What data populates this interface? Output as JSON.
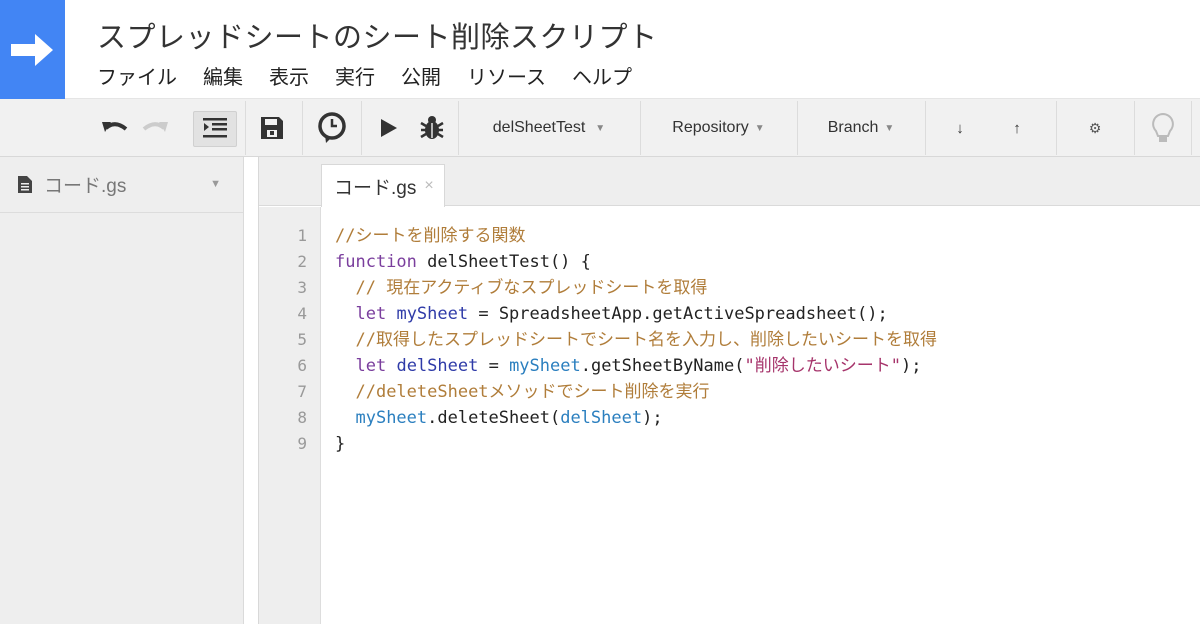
{
  "app": {
    "title": "スプレッドシートのシート削除スクリプト",
    "brand_color": "#4285f4",
    "logo_icon": "arrow-right-icon"
  },
  "menu": [
    {
      "label": "ファイル"
    },
    {
      "label": "編集"
    },
    {
      "label": "表示"
    },
    {
      "label": "実行"
    },
    {
      "label": "公開"
    },
    {
      "label": "リソース"
    },
    {
      "label": "ヘルプ"
    }
  ],
  "toolbar": {
    "undo_icon": "undo-icon",
    "redo_icon": "redo-icon",
    "indent_icon": "indent-icon",
    "save_icon": "save-icon",
    "triggers_icon": "clock-icon",
    "run_icon": "play-icon",
    "debug_icon": "bug-icon",
    "function_select": "delSheetTest",
    "repository_label": "Repository",
    "branch_label": "Branch",
    "pull_icon": "↓",
    "push_icon": "↑",
    "settings_icon": "⚙",
    "hint_icon": "lightbulb-icon"
  },
  "sidebar": {
    "files": [
      {
        "name": "コード.gs",
        "icon": "file-icon"
      }
    ]
  },
  "editor": {
    "tabs": [
      {
        "label": "コード.gs",
        "close": "×"
      }
    ],
    "line_numbers": [
      "1",
      "2",
      "3",
      "4",
      "5",
      "6",
      "7",
      "8",
      "9"
    ],
    "lines": [
      [
        {
          "t": "//シートを削除する関数",
          "c": "cm-comment"
        }
      ],
      [
        {
          "t": "function",
          "c": "cm-keyword"
        },
        {
          "t": " delSheetTest() {",
          "c": "cm-plain"
        }
      ],
      [
        {
          "t": "  ",
          "c": "cm-plain"
        },
        {
          "t": "// 現在アクティブなスプレッドシートを取得",
          "c": "cm-comment"
        }
      ],
      [
        {
          "t": "  ",
          "c": "cm-plain"
        },
        {
          "t": "let",
          "c": "cm-keyword"
        },
        {
          "t": " ",
          "c": "cm-plain"
        },
        {
          "t": "mySheet",
          "c": "cm-def"
        },
        {
          "t": " = SpreadsheetApp.getActiveSpreadsheet();",
          "c": "cm-plain"
        }
      ],
      [
        {
          "t": "  ",
          "c": "cm-plain"
        },
        {
          "t": "//取得したスプレッドシートでシート名を入力し、削除したいシートを取得",
          "c": "cm-comment"
        }
      ],
      [
        {
          "t": "  ",
          "c": "cm-plain"
        },
        {
          "t": "let",
          "c": "cm-keyword"
        },
        {
          "t": " ",
          "c": "cm-plain"
        },
        {
          "t": "delSheet",
          "c": "cm-def"
        },
        {
          "t": " = ",
          "c": "cm-plain"
        },
        {
          "t": "mySheet",
          "c": "cm-var"
        },
        {
          "t": ".getSheetByName(",
          "c": "cm-plain"
        },
        {
          "t": "\"削除したいシート\"",
          "c": "cm-string"
        },
        {
          "t": ");",
          "c": "cm-plain"
        }
      ],
      [
        {
          "t": "  ",
          "c": "cm-plain"
        },
        {
          "t": "//deleteSheetメソッドでシート削除を実行",
          "c": "cm-comment"
        }
      ],
      [
        {
          "t": "  ",
          "c": "cm-plain"
        },
        {
          "t": "mySheet",
          "c": "cm-var"
        },
        {
          "t": ".deleteSheet(",
          "c": "cm-plain"
        },
        {
          "t": "delSheet",
          "c": "cm-var"
        },
        {
          "t": ");",
          "c": "cm-plain"
        }
      ],
      [
        {
          "t": "}",
          "c": "cm-plain"
        }
      ]
    ]
  }
}
